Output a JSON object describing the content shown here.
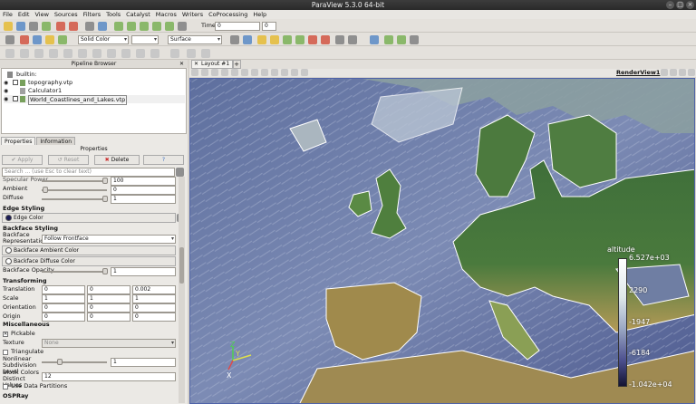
{
  "window": {
    "title": "ParaView 5.3.0 64-bit"
  },
  "menu": [
    "File",
    "Edit",
    "View",
    "Sources",
    "Filters",
    "Tools",
    "Catalyst",
    "Macros",
    "Writers",
    "CoProcessing",
    "Help"
  ],
  "toolbar": {
    "time_label": "Time:",
    "time_value": "0",
    "time_step": "0",
    "color_by": "Solid Color",
    "representation": "Surface"
  },
  "pipeline_browser": {
    "title": "Pipeline Browser",
    "items": [
      {
        "label": "builtin:"
      },
      {
        "label": "topography.vtp"
      },
      {
        "label": "Calculator1"
      },
      {
        "label": "World_Coastlines_and_Lakes.vtp"
      }
    ]
  },
  "properties": {
    "tabs": [
      "Properties",
      "Information"
    ],
    "title": "Properties",
    "apply_label": "Apply",
    "reset_label": "Reset",
    "delete_label": "Delete",
    "help_label": "?",
    "search_placeholder": "Search ... (use Esc to clear text)",
    "specular_power_label": "Specular Power",
    "specular_power_value": "100",
    "ambient_label": "Ambient",
    "ambient_value": "0",
    "diffuse_label": "Diffuse",
    "diffuse_value": "1",
    "edge_styling_header": "Edge Styling",
    "edge_color_label": "Edge Color",
    "backface_styling_header": "Backface Styling",
    "backface_rep_label": "Backface Representation",
    "backface_rep_value": "Follow Frontface",
    "backface_ambient_label": "Backface Ambient Color",
    "backface_diffuse_label": "Backface Diffuse Color",
    "backface_opacity_label": "Backface Opacity",
    "backface_opacity_value": "1",
    "transforming_header": "Transforming",
    "translation_label": "Translation",
    "translation": [
      "0",
      "0",
      "0.002"
    ],
    "scale_label": "Scale",
    "scale": [
      "1",
      "1",
      "1"
    ],
    "orientation_label": "Orientation",
    "orientation": [
      "0",
      "0",
      "0"
    ],
    "origin_label": "Origin",
    "origin": [
      "0",
      "0",
      "0"
    ],
    "misc_header": "Miscellaneous",
    "pickable_label": "Pickable",
    "texture_label": "Texture",
    "texture_value": "None",
    "triangulate_label": "Triangulate",
    "nonlinear_label": "Nonlinear Subdivision Level",
    "nonlinear_value": "1",
    "block_colors_label": "Block Colors Distinct Values",
    "block_colors_value": "12",
    "data_partitions_label": "Use Data Partitions",
    "ospray_header": "OSPRay"
  },
  "layout": {
    "tab_label": "Layout #1",
    "add_tab": "+",
    "view_name": "RenderView1"
  },
  "legend": {
    "title": "altitude",
    "labels": [
      "6.527e+03",
      "2290",
      "-1947",
      "-6184",
      "-1.042e+04"
    ],
    "colors": [
      "#ffffff",
      "#dfe8ea",
      "#9aa7c4",
      "#4c4f8e",
      "#141432"
    ]
  },
  "axes": {
    "x": "X",
    "y": "Y",
    "z": "Z"
  }
}
